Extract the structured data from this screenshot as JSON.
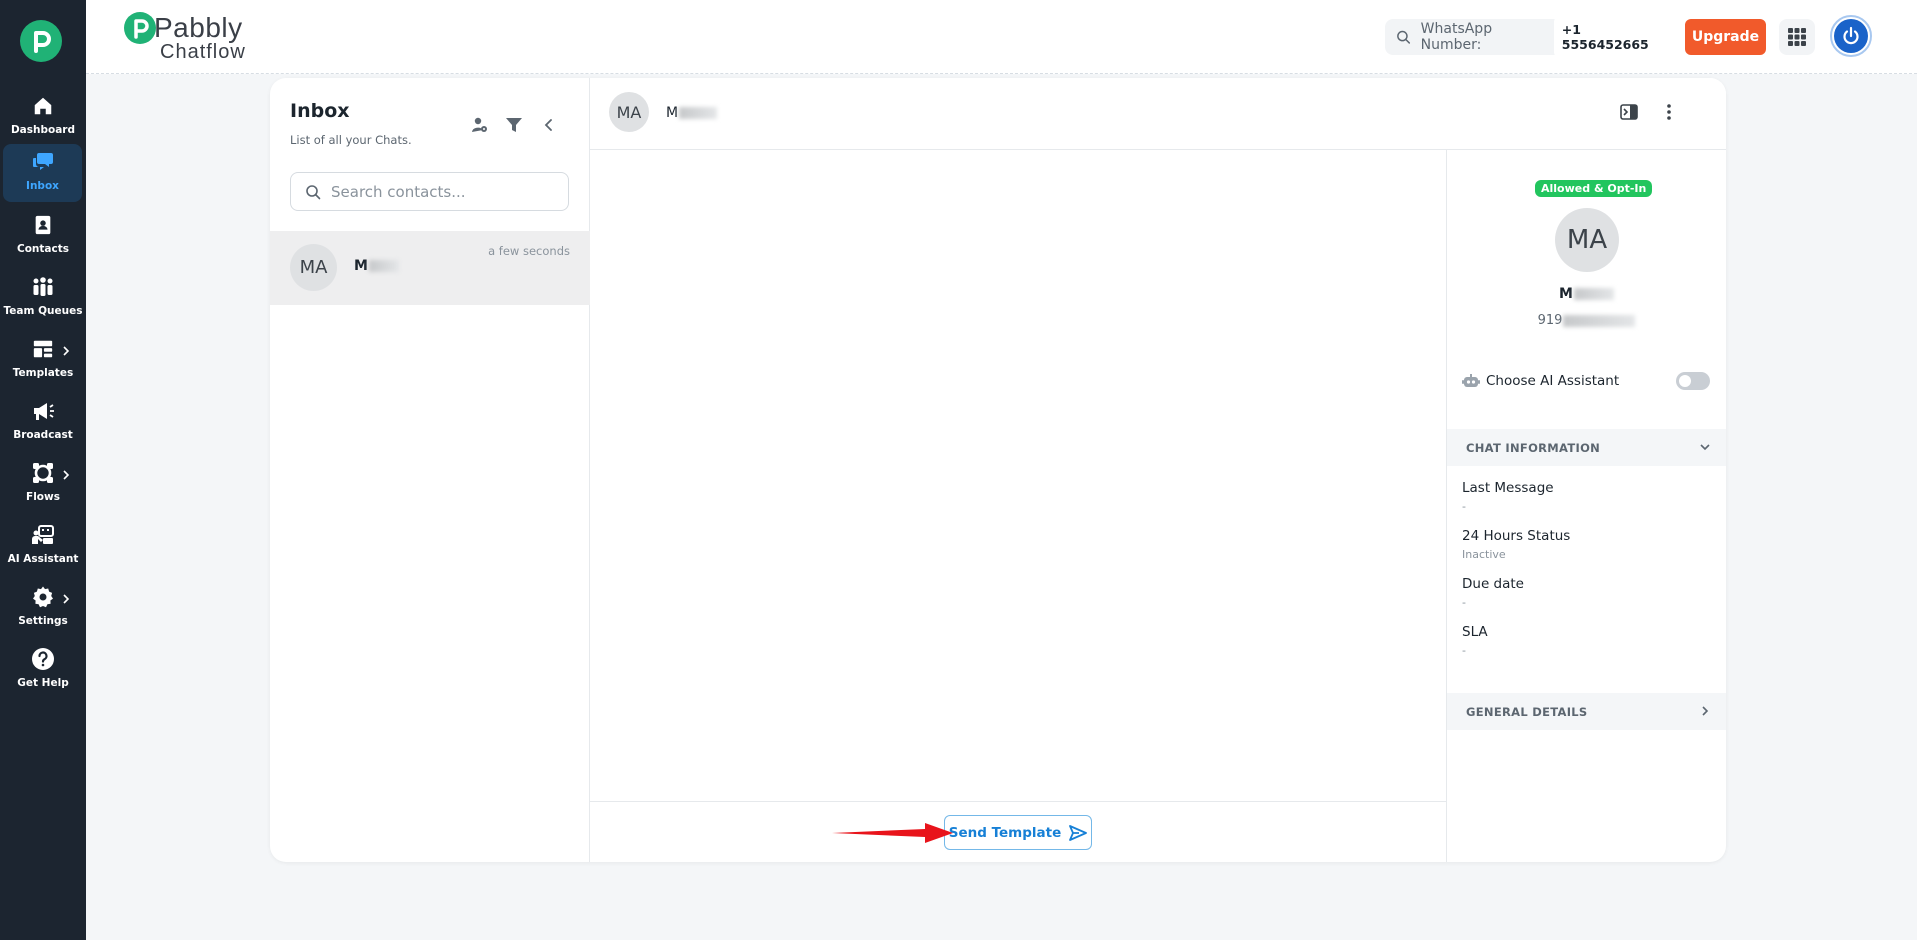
{
  "sidebar": {
    "items": [
      {
        "label": "Dashboard",
        "icon": "home-icon"
      },
      {
        "label": "Inbox",
        "icon": "chat-bubbles-icon"
      },
      {
        "label": "Contacts",
        "icon": "contact-book-icon"
      },
      {
        "label": "Team Queues",
        "icon": "team-icon"
      },
      {
        "label": "Templates",
        "icon": "template-icon"
      },
      {
        "label": "Broadcast",
        "icon": "megaphone-icon"
      },
      {
        "label": "Flows",
        "icon": "flows-icon"
      },
      {
        "label": "AI Assistant",
        "icon": "ai-assistant-icon"
      },
      {
        "label": "Settings",
        "icon": "gear-icon"
      },
      {
        "label": "Get Help",
        "icon": "help-icon"
      }
    ],
    "active": "Inbox"
  },
  "header": {
    "brand_name": "Pabbly",
    "brand_sub": "Chatflow",
    "whatsapp_label": "WhatsApp Number:",
    "whatsapp_number": "+1 5556452665",
    "upgrade_label": "Upgrade"
  },
  "inbox": {
    "title": "Inbox",
    "subtitle": "List of all your Chats.",
    "search_placeholder": "Search contacts...",
    "chats": [
      {
        "initials": "MA",
        "name": "M",
        "time": "a few seconds"
      }
    ]
  },
  "conversation": {
    "initials": "MA",
    "name": "M",
    "send_template_label": "Send Template"
  },
  "details": {
    "badge": "Allowed & Opt-In",
    "initials": "MA",
    "name": "M",
    "phone": "919",
    "ai_label": "Choose AI Assistant",
    "chat_info_heading": "CHAT INFORMATION",
    "fields": [
      {
        "label": "Last Message",
        "value": "-"
      },
      {
        "label": "24 Hours Status",
        "value": "Inactive"
      },
      {
        "label": "Due date",
        "value": "-"
      },
      {
        "label": "SLA",
        "value": "-"
      }
    ],
    "general_heading": "GENERAL DETAILS"
  },
  "colors": {
    "sidebar_bg": "#1c2530",
    "brand_green": "#20b276",
    "upgrade": "#f15a2b",
    "accent_blue": "#1780d6",
    "badge_green": "#22c55e",
    "arrow_red": "#e8141b"
  }
}
